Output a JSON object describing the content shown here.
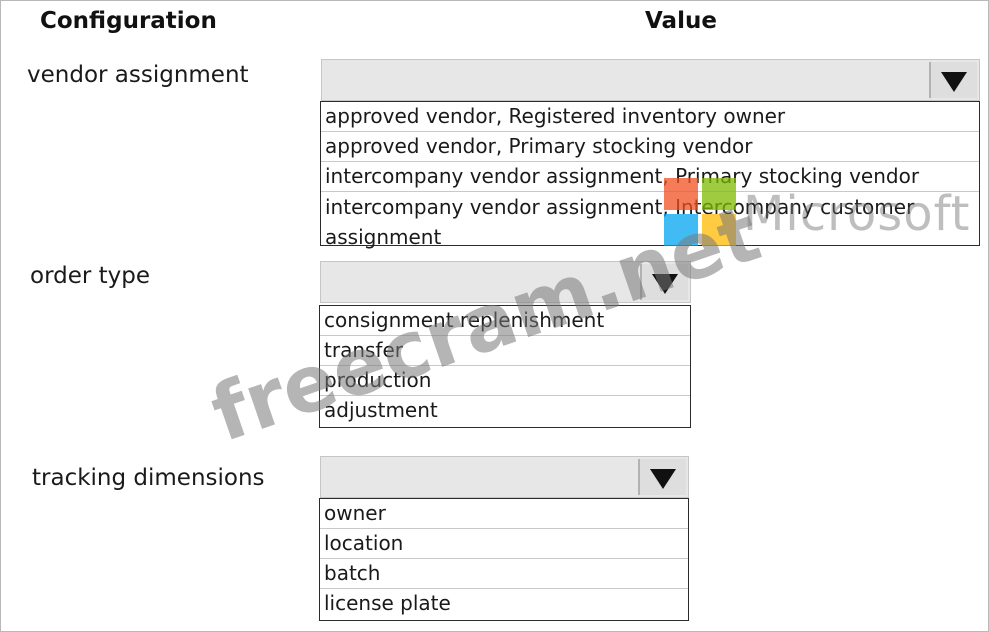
{
  "headers": {
    "configuration": "Configuration",
    "value": "Value"
  },
  "rows": [
    {
      "label": "vendor assignment",
      "options": [
        "approved vendor, Registered inventory owner",
        "approved vendor, Primary stocking vendor",
        "intercompany vendor assignment, Primary stocking vendor",
        "intercompany vendor assignment, Intercompany customer assignment"
      ]
    },
    {
      "label": "order type",
      "options": [
        "consignment replenishment",
        "transfer",
        "production",
        "adjustment"
      ]
    },
    {
      "label": "tracking dimensions",
      "options": [
        "owner",
        "location",
        "batch",
        "license plate"
      ]
    }
  ],
  "icons": {
    "dropdown_arrow": "triangle-down-icon",
    "logo": "microsoft-logo"
  },
  "watermark": {
    "brand_text": "Microsoft",
    "site_text": "freecram.net"
  },
  "colors": {
    "dropdown_bg": "#e7e7e7",
    "logo_red": "#f25022",
    "logo_green": "#7fba00",
    "logo_blue": "#00a4ef",
    "logo_yellow": "#ffb900"
  }
}
